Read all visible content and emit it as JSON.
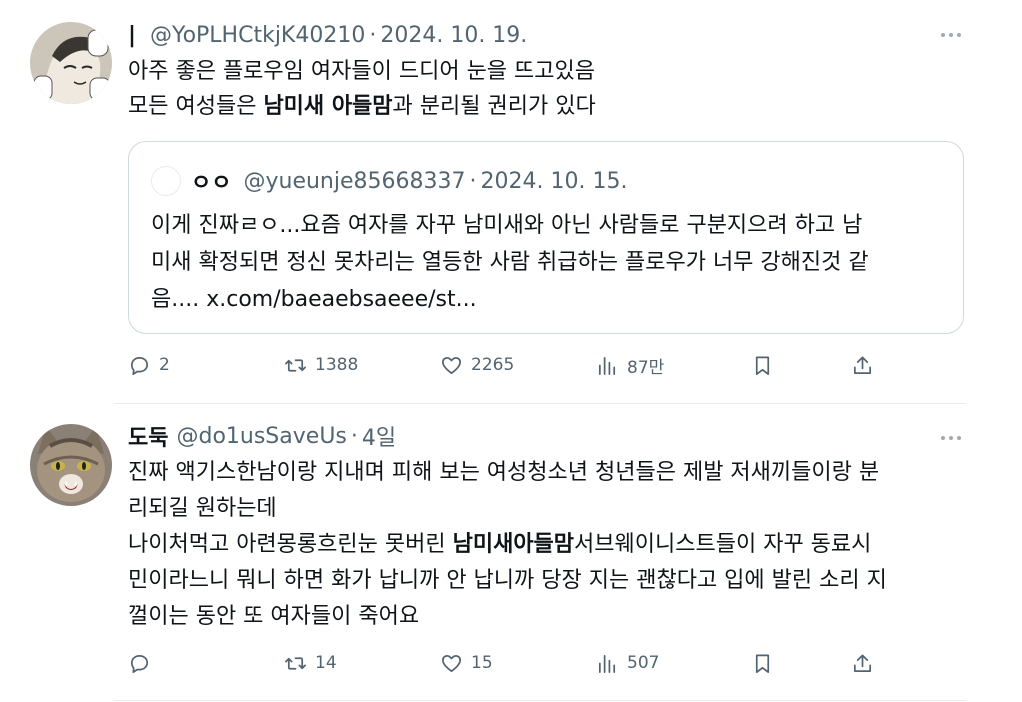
{
  "post1": {
    "marker": "|",
    "handle": "@YoPLHCtkjK40210",
    "separator": "·",
    "date": "2024. 10. 19.",
    "lines": [
      "아주 좋은 플로우임 여자들이 드디어 눈을 뜨고있음",
      {
        "pre": "모든 여성들은 ",
        "bold": "남미새 아들맘",
        "post": "과 분리될 권리가 있다"
      }
    ],
    "quote": {
      "name": "ㅇㅇ",
      "handle": "@yueunje85668337",
      "separator": "·",
      "date": "2024. 10. 15.",
      "lines": [
        "이게 진짜ㄹㅇ...요즘 여자를 자꾸 남미새와 아닌 사람들로 구분지으려 하고 남",
        "미새 확정되면 정신 못차리는 열등한 사람 취급하는 플로우가 너무 강해진것 같",
        "음.... x.com/baeaebsaeee/st..."
      ]
    },
    "actions": {
      "replies": "2",
      "retweets": "1388",
      "likes": "2265",
      "views": "87만"
    }
  },
  "post2": {
    "name": "도둑",
    "handle": "@do1usSaveUs",
    "separator": "·",
    "date": "4일",
    "lines": [
      "진짜 액기스한남이랑 지내며 피해 보는 여성청소년 청년들은 제발 저새끼들이랑 분",
      "리되길 원하는데",
      {
        "pre": "나이처먹고 아련몽롱흐린눈 못버린 ",
        "bold": "남미새아들맘",
        "post": "서브웨이니스트들이 자꾸 동료시"
      },
      "민이라느니 뭐니 하면 화가 납니까 안 납니까 당장 지는 괜찮다고 입에 발린 소리 지",
      "껄이는 동안 또 여자들이 죽어요"
    ],
    "actions": {
      "replies": "",
      "retweets": "14",
      "likes": "15",
      "views": "507"
    }
  },
  "icons": {
    "reply": "reply-icon",
    "retweet": "retweet-icon",
    "like": "like-icon",
    "views": "views-icon",
    "bookmark": "bookmark-icon",
    "share": "share-icon",
    "more": "more-icon"
  },
  "colors": {
    "text": "#0f1419",
    "secondary": "#536471",
    "border": "#cfd9de",
    "divider": "#e6ecf0"
  }
}
